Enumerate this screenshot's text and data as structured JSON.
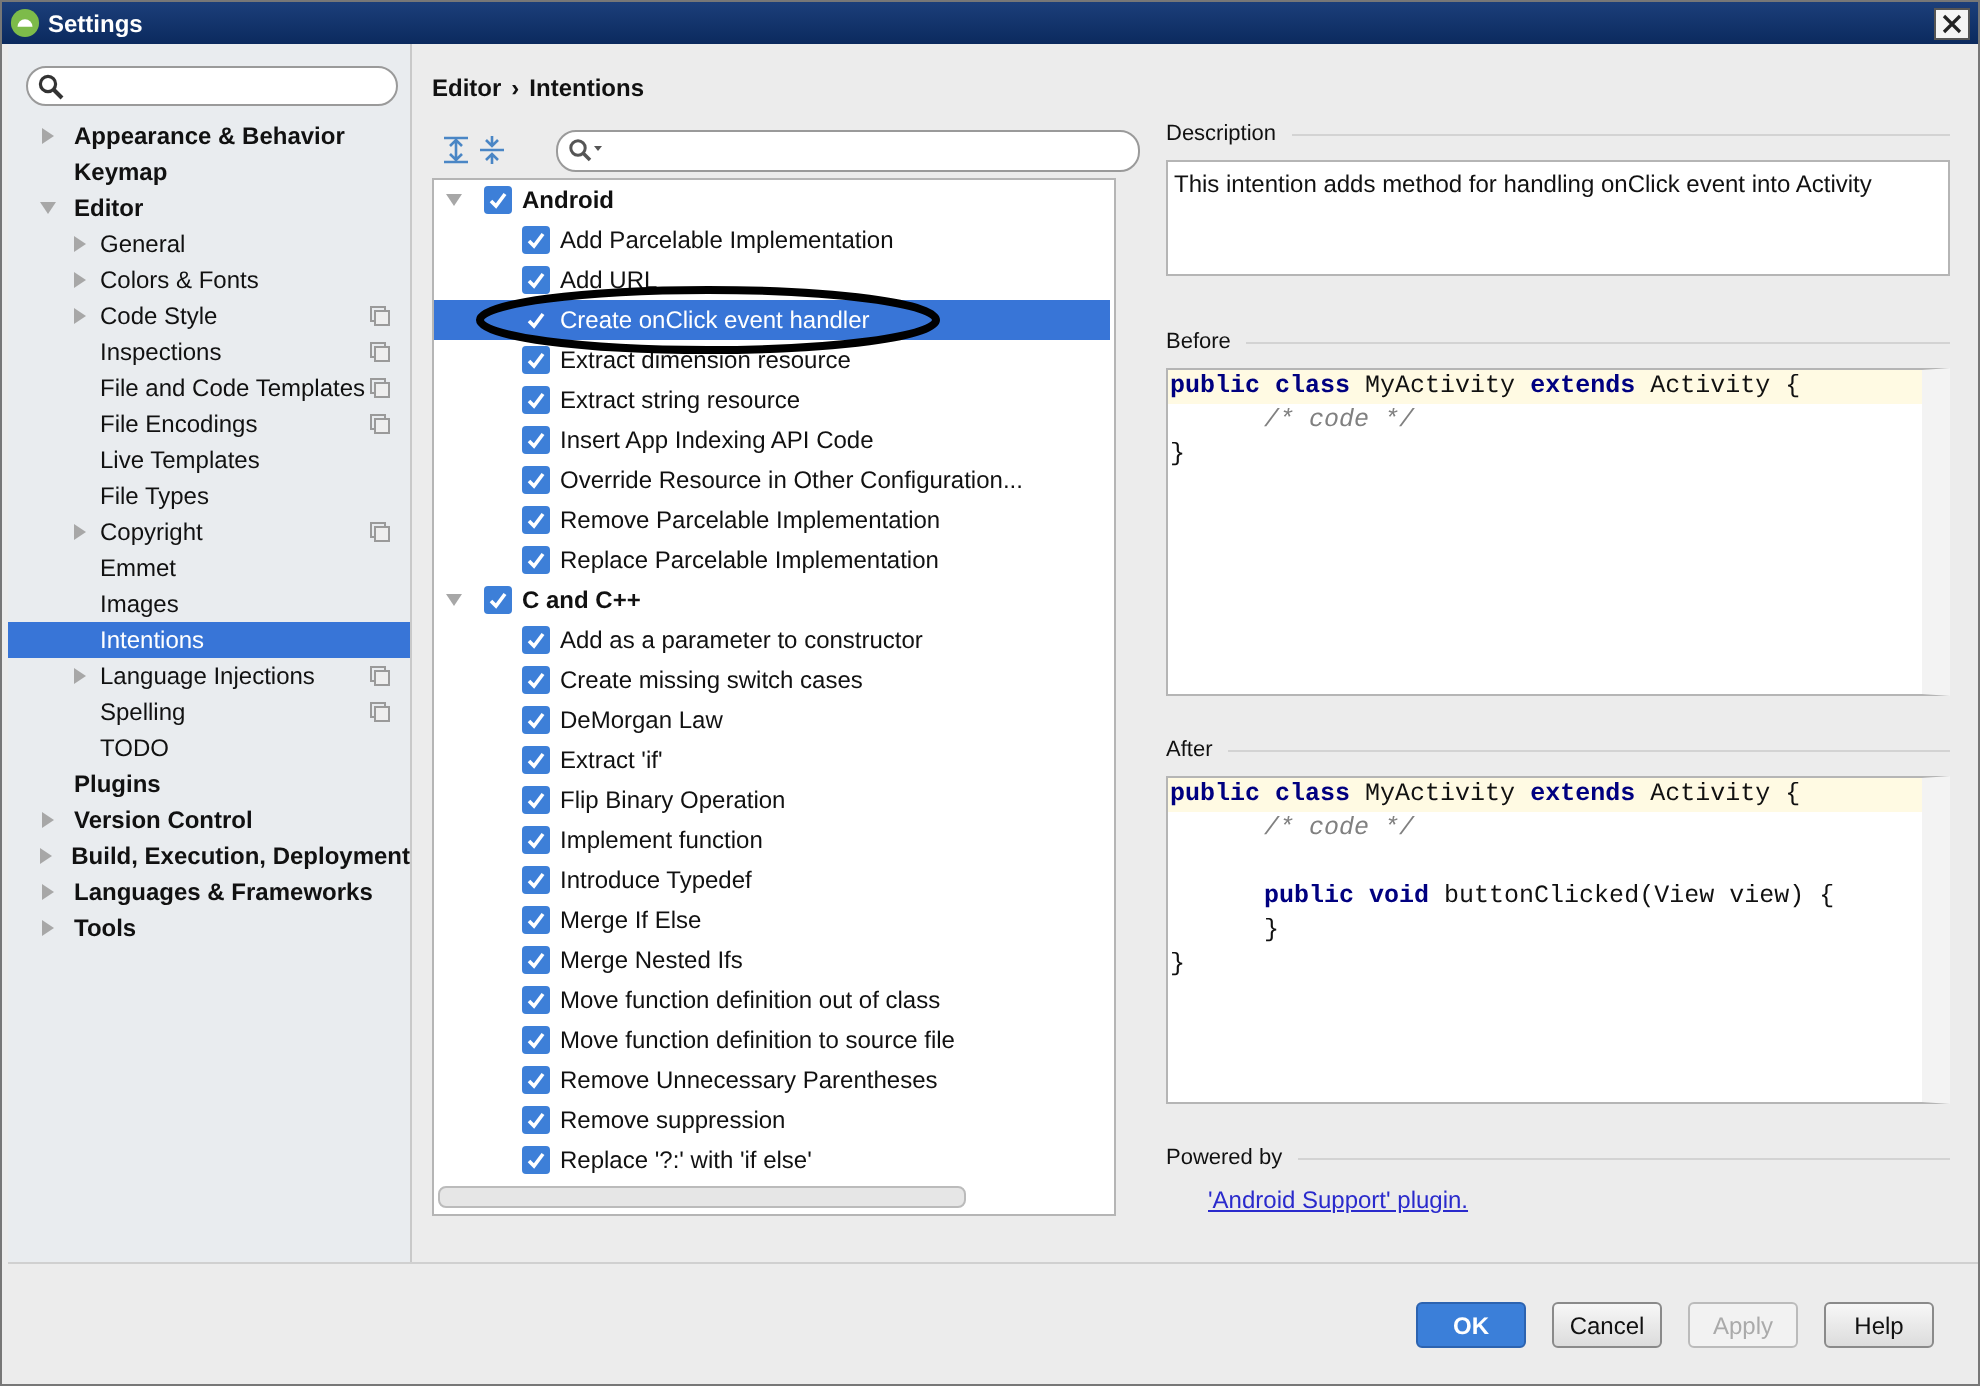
{
  "window": {
    "title": "Settings"
  },
  "sidebar": {
    "items": [
      {
        "label": "Appearance & Behavior",
        "expanded": false,
        "selected": false,
        "shared": false
      },
      {
        "label": "Keymap",
        "selected": false,
        "shared": false
      },
      {
        "label": "Editor",
        "expanded": true,
        "selected": false,
        "shared": false,
        "children": [
          {
            "label": "General",
            "expanded": false,
            "selected": false,
            "shared": false
          },
          {
            "label": "Colors & Fonts",
            "expanded": false,
            "selected": false,
            "shared": false
          },
          {
            "label": "Code Style",
            "expanded": false,
            "selected": false,
            "shared": true
          },
          {
            "label": "Inspections",
            "selected": false,
            "shared": true
          },
          {
            "label": "File and Code Templates",
            "selected": false,
            "shared": true
          },
          {
            "label": "File Encodings",
            "selected": false,
            "shared": true
          },
          {
            "label": "Live Templates",
            "selected": false,
            "shared": false
          },
          {
            "label": "File Types",
            "selected": false,
            "shared": false
          },
          {
            "label": "Copyright",
            "expanded": false,
            "selected": false,
            "shared": true
          },
          {
            "label": "Emmet",
            "selected": false,
            "shared": false
          },
          {
            "label": "Images",
            "selected": false,
            "shared": false
          },
          {
            "label": "Intentions",
            "selected": true,
            "shared": false
          },
          {
            "label": "Language Injections",
            "expanded": false,
            "selected": false,
            "shared": true
          },
          {
            "label": "Spelling",
            "selected": false,
            "shared": true
          },
          {
            "label": "TODO",
            "selected": false,
            "shared": false
          }
        ]
      },
      {
        "label": "Plugins",
        "selected": false,
        "shared": false
      },
      {
        "label": "Version Control",
        "expanded": false,
        "selected": false,
        "shared": false
      },
      {
        "label": "Build, Execution, Deployment",
        "expanded": false,
        "selected": false,
        "shared": false
      },
      {
        "label": "Languages & Frameworks",
        "expanded": false,
        "selected": false,
        "shared": false
      },
      {
        "label": "Tools",
        "expanded": false,
        "selected": false,
        "shared": false
      }
    ]
  },
  "breadcrumb": {
    "path": [
      "Editor",
      "Intentions"
    ],
    "separator": "›"
  },
  "intentions": [
    {
      "label": "Android",
      "checked": true,
      "expanded": true,
      "selected": false,
      "children": [
        {
          "label": "Add Parcelable Implementation",
          "checked": true,
          "selected": false
        },
        {
          "label": "Add URL",
          "checked": true,
          "selected": false
        },
        {
          "label": "Create onClick event handler",
          "checked": true,
          "selected": true
        },
        {
          "label": "Extract dimension resource",
          "checked": true,
          "selected": false
        },
        {
          "label": "Extract string resource",
          "checked": true,
          "selected": false
        },
        {
          "label": "Insert App Indexing API Code",
          "checked": true,
          "selected": false
        },
        {
          "label": "Override Resource in Other Configuration...",
          "checked": true,
          "selected": false
        },
        {
          "label": "Remove Parcelable Implementation",
          "checked": true,
          "selected": false
        },
        {
          "label": "Replace Parcelable Implementation",
          "checked": true,
          "selected": false
        }
      ]
    },
    {
      "label": "C and C++",
      "checked": true,
      "expanded": true,
      "selected": false,
      "children": [
        {
          "label": "Add as a parameter to constructor",
          "checked": true,
          "selected": false
        },
        {
          "label": "Create missing switch cases",
          "checked": true,
          "selected": false
        },
        {
          "label": "DeMorgan Law",
          "checked": true,
          "selected": false
        },
        {
          "label": "Extract 'if'",
          "checked": true,
          "selected": false
        },
        {
          "label": "Flip Binary Operation",
          "checked": true,
          "selected": false
        },
        {
          "label": "Implement function",
          "checked": true,
          "selected": false
        },
        {
          "label": "Introduce Typedef",
          "checked": true,
          "selected": false
        },
        {
          "label": "Merge If Else",
          "checked": true,
          "selected": false
        },
        {
          "label": "Merge Nested Ifs",
          "checked": true,
          "selected": false
        },
        {
          "label": "Move function definition out of class",
          "checked": true,
          "selected": false
        },
        {
          "label": "Move function definition to source file",
          "checked": true,
          "selected": false
        },
        {
          "label": "Remove Unnecessary Parentheses",
          "checked": true,
          "selected": false
        },
        {
          "label": "Remove suppression",
          "checked": true,
          "selected": false
        },
        {
          "label": "Replace '?:' with 'if else'",
          "checked": true,
          "selected": false
        }
      ]
    }
  ],
  "description": {
    "label": "Description",
    "text": "This intention adds method for handling onClick event into Activity"
  },
  "before": {
    "label": "Before",
    "lines": [
      {
        "kind": "code",
        "current": true,
        "indented": false,
        "text": "**public** **class** MyActivity **extends** Activity {"
      },
      {
        "kind": "comment",
        "current": false,
        "indented": true,
        "text": "/* code */"
      },
      {
        "kind": "code",
        "current": false,
        "indented": false,
        "text": "}"
      }
    ]
  },
  "after": {
    "label": "After",
    "lines": [
      {
        "kind": "code",
        "current": true,
        "indented": false,
        "text": "**public** **class** MyActivity **extends** Activity {"
      },
      {
        "kind": "comment",
        "current": false,
        "indented": true,
        "text": "/* code */"
      },
      {
        "kind": "blank"
      },
      {
        "kind": "code",
        "current": false,
        "indented": true,
        "text": "**public** **void** buttonClicked(View view) {"
      },
      {
        "kind": "code",
        "current": false,
        "indented": true,
        "text": "}"
      },
      {
        "kind": "code",
        "current": false,
        "indented": false,
        "text": "}"
      }
    ]
  },
  "powered_by": {
    "label": "Powered by",
    "link": "'Android Support' plugin."
  },
  "buttons": [
    {
      "label": "OK",
      "kind": "default",
      "disabled": false
    },
    {
      "label": "Cancel",
      "kind": "normal",
      "disabled": false
    },
    {
      "label": "Apply",
      "kind": "normal",
      "disabled": true
    },
    {
      "label": "Help",
      "kind": "normal",
      "disabled": false
    }
  ]
}
